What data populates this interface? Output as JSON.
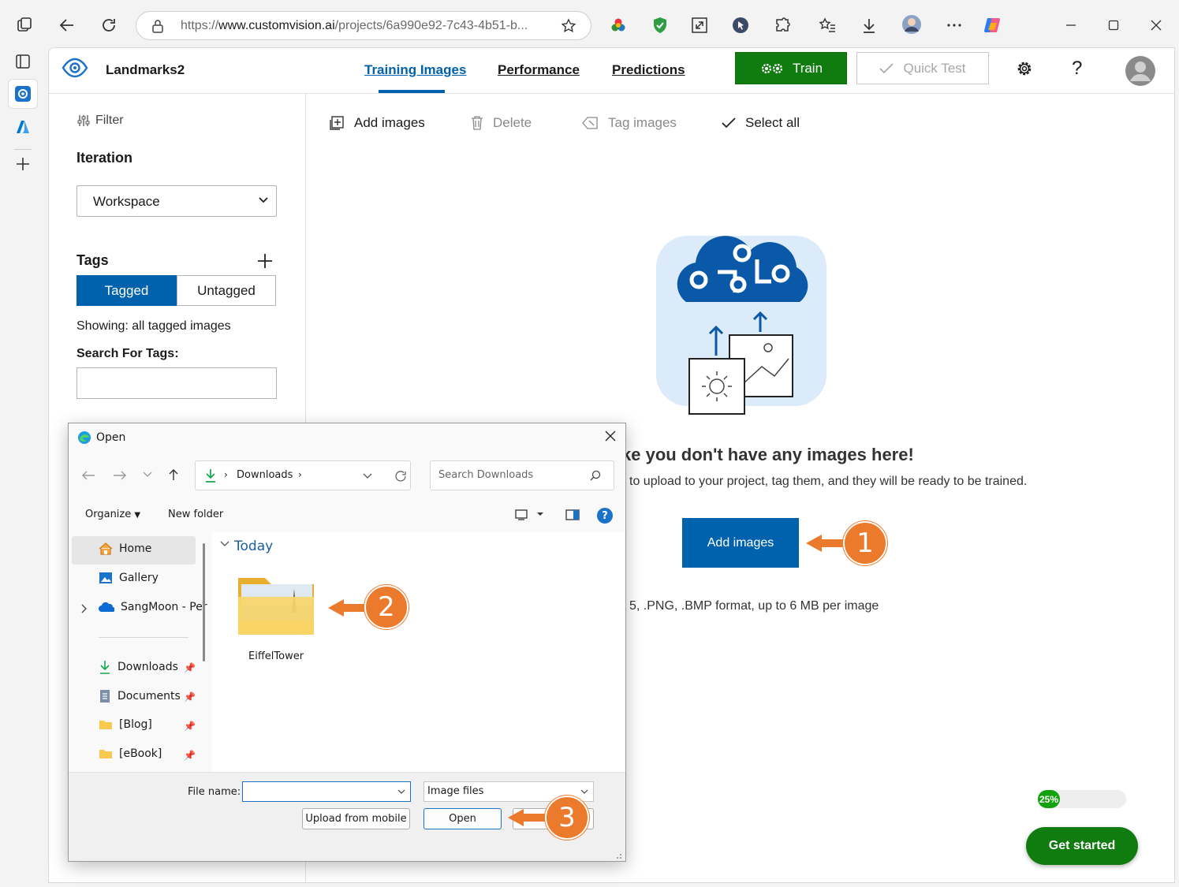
{
  "browser": {
    "url_prefix": "https://",
    "url_domain": "www.customvision.ai",
    "url_path": "/projects/6a990e92-7c43-4b51-b..."
  },
  "app": {
    "project_name": "Landmarks2",
    "tabs": [
      "Training Images",
      "Performance",
      "Predictions"
    ],
    "train_label": "Train",
    "quicktest_label": "Quick Test",
    "help_label": "?"
  },
  "sidebar": {
    "filter_label": "Filter",
    "iteration_heading": "Iteration",
    "iteration_value": "Workspace",
    "tags_heading": "Tags",
    "tagged_label": "Tagged",
    "untagged_label": "Untagged",
    "showing_text": "Showing: all tagged images",
    "search_label": "Search For Tags:",
    "search_value": ""
  },
  "toolbar": {
    "add_images": "Add images",
    "delete": "Delete",
    "tag_images": "Tag images",
    "select_all": "Select all"
  },
  "empty_state": {
    "title": "ke you don't have any images here!",
    "subtitle": "to upload to your project, tag them, and they will be ready to be trained.",
    "add_button": "Add images",
    "formats": "5, .PNG, .BMP format, up to 6 MB per image"
  },
  "onboarding": {
    "progress_text": "25%",
    "progress_value": 0.25,
    "get_started": "Get started"
  },
  "dialog": {
    "title": "Open",
    "path_segment": "Downloads",
    "search_placeholder": "Search Downloads",
    "organize": "Organize",
    "new_folder": "New folder",
    "nav": {
      "home": "Home",
      "gallery": "Gallery",
      "onedrive": "SangMoon - Per",
      "downloads": "Downloads",
      "documents": "Documents",
      "blog": "[Blog]",
      "ebook": "[eBook]"
    },
    "group_label": "Today",
    "folder_name": "EiffelTower",
    "filename_label": "File name:",
    "filename_value": "",
    "filetype_value": "Image files",
    "upload_mobile": "Upload from mobile",
    "open_button": "Open",
    "help_glyph": "?"
  },
  "annotations": [
    "1",
    "2",
    "3"
  ],
  "colors": {
    "accent_blue": "#0062ad",
    "train_green": "#107c10",
    "annotation_orange": "#ec7a2c"
  }
}
